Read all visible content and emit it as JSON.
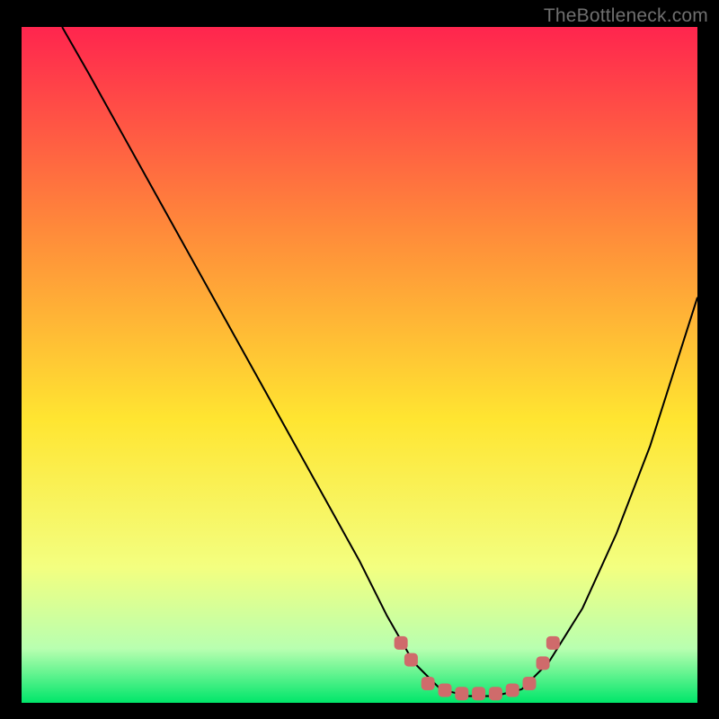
{
  "watermark": "TheBottleneck.com",
  "colors": {
    "gradient_top": "#ff254e",
    "gradient_mid_upper": "#ff8a3a",
    "gradient_mid": "#ffe531",
    "gradient_mid_lower": "#f3ff80",
    "gradient_lower": "#b8ffb0",
    "gradient_bottom": "#00e66a",
    "curve_stroke": "#000000",
    "marker_fill": "#cf6b6b",
    "marker_stroke": "#cf6b6b"
  },
  "chart_data": {
    "type": "line",
    "title": "",
    "xlabel": "",
    "ylabel": "",
    "xlim": [
      0,
      100
    ],
    "ylim": [
      0,
      100
    ],
    "series": [
      {
        "name": "bottleneck-curve",
        "x": [
          6,
          10,
          15,
          20,
          25,
          30,
          35,
          40,
          45,
          50,
          54,
          58,
          62,
          66,
          70,
          74,
          78,
          83,
          88,
          93,
          100
        ],
        "y": [
          100,
          93,
          84,
          75,
          66,
          57,
          48,
          39,
          30,
          21,
          13,
          6,
          2,
          1,
          1,
          2,
          6,
          14,
          25,
          38,
          60
        ]
      }
    ],
    "markers": [
      {
        "x": 56,
        "y": 9
      },
      {
        "x": 57.5,
        "y": 6.5
      },
      {
        "x": 60,
        "y": 3
      },
      {
        "x": 62.5,
        "y": 2
      },
      {
        "x": 65,
        "y": 1.5
      },
      {
        "x": 67.5,
        "y": 1.5
      },
      {
        "x": 70,
        "y": 1.5
      },
      {
        "x": 72.5,
        "y": 2
      },
      {
        "x": 75,
        "y": 3
      },
      {
        "x": 77,
        "y": 6
      },
      {
        "x": 78.5,
        "y": 9
      }
    ]
  }
}
